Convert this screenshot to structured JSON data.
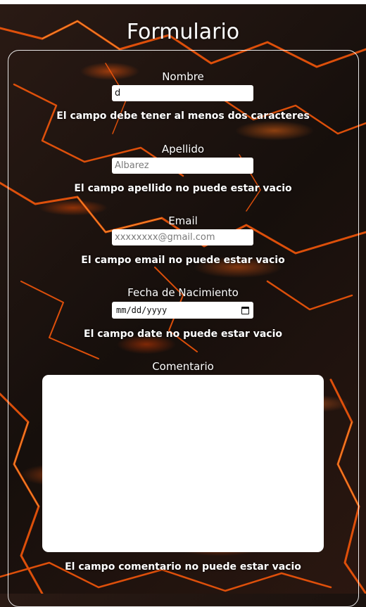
{
  "page": {
    "title": "Formulario"
  },
  "form": {
    "nombre": {
      "label": "Nombre",
      "value": "d",
      "placeholder": "",
      "error": "El campo debe tener al menos dos caracteres"
    },
    "apellido": {
      "label": "Apellido",
      "value": "",
      "placeholder": "Albarez",
      "error": "El campo apellido no puede estar vacio"
    },
    "email": {
      "label": "Email",
      "value": "",
      "placeholder": "xxxxxxxx@gmail.com",
      "error": "El campo email no puede estar vacio"
    },
    "fecha": {
      "label": "Fecha de Nacimiento",
      "display": "mm/dd/yyyy",
      "icon": "calendar-icon",
      "error": "El campo date no puede estar vacio"
    },
    "comentario": {
      "label": "Comentario",
      "value": "",
      "error": "El campo comentario no puede estar vacio"
    }
  },
  "colors": {
    "text": "#ffffff",
    "input_bg": "#ffffff",
    "lava": "#ff5a0a"
  }
}
